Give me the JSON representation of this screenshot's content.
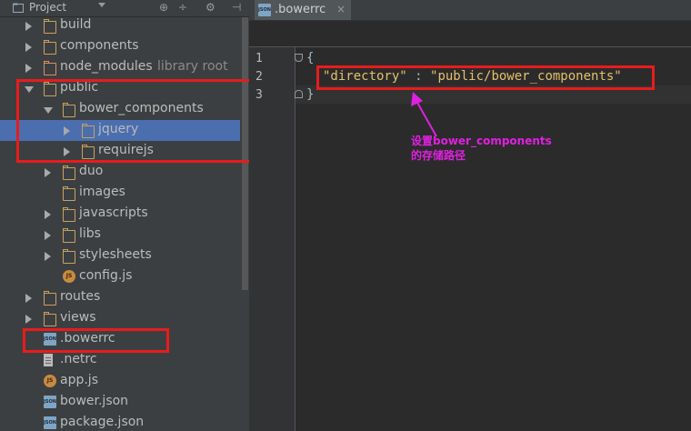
{
  "project_panel": {
    "title": "Project",
    "tools": [
      "⊕",
      "÷",
      "⚙",
      "⊣"
    ]
  },
  "tree": [
    {
      "label": "build",
      "type": "folder",
      "depth": 0,
      "expanded": false
    },
    {
      "label": "components",
      "type": "folder",
      "depth": 0,
      "expanded": false
    },
    {
      "label": "node_modules",
      "type": "folder",
      "depth": 0,
      "expanded": false,
      "hint": "library root"
    },
    {
      "label": "public",
      "type": "folder",
      "depth": 0,
      "expanded": true
    },
    {
      "label": "bower_components",
      "type": "folder",
      "depth": 1,
      "expanded": true
    },
    {
      "label": "jquery",
      "type": "folder",
      "depth": 2,
      "expanded": false,
      "selected": true
    },
    {
      "label": "requirejs",
      "type": "folder",
      "depth": 2,
      "expanded": false
    },
    {
      "label": "duo",
      "type": "folder",
      "depth": 1,
      "expanded": false
    },
    {
      "label": "images",
      "type": "folder",
      "depth": 1,
      "leaf": true
    },
    {
      "label": "javascripts",
      "type": "folder",
      "depth": 1,
      "expanded": false
    },
    {
      "label": "libs",
      "type": "folder",
      "depth": 1,
      "expanded": false
    },
    {
      "label": "stylesheets",
      "type": "folder",
      "depth": 1,
      "expanded": false
    },
    {
      "label": "config.js",
      "type": "js",
      "depth": 1
    },
    {
      "label": "routes",
      "type": "folder",
      "depth": 0,
      "expanded": false
    },
    {
      "label": "views",
      "type": "folder",
      "depth": 0,
      "expanded": false
    },
    {
      "label": ".bowerrc",
      "type": "json",
      "depth": 0
    },
    {
      "label": ".netrc",
      "type": "plain",
      "depth": 0
    },
    {
      "label": "app.js",
      "type": "js",
      "depth": 0
    },
    {
      "label": "bower.json",
      "type": "json",
      "depth": 0
    },
    {
      "label": "package.json",
      "type": "json",
      "depth": 0
    }
  ],
  "editor": {
    "tab_label": ".bowerrc",
    "tab_close": "×",
    "line_numbers": [
      "1",
      "2",
      "3"
    ],
    "code": {
      "open": "{",
      "key": "\"directory\"",
      "sep": " : ",
      "value": "\"public/bower_components\"",
      "close": "}"
    }
  },
  "annotation": {
    "line1": "设置bower_components",
    "line2": "的存储路径",
    "color": "#e020e0"
  },
  "colors": {
    "panel": "#3c3f41",
    "editor": "#2b2b2b",
    "selection": "#4b6eaf",
    "highlight": "#e81c1c"
  }
}
